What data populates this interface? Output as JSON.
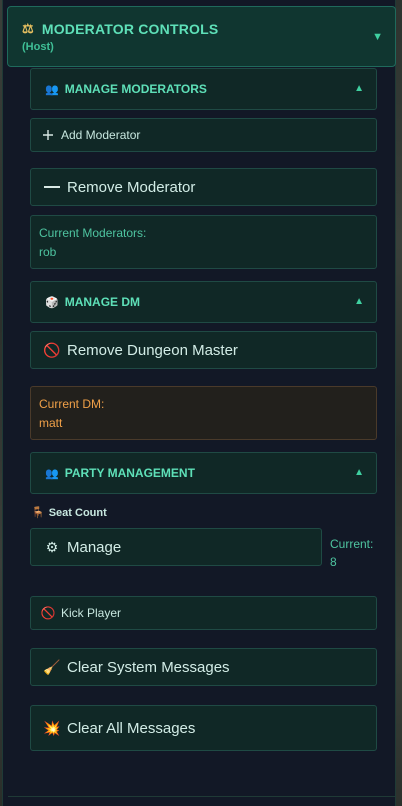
{
  "header": {
    "icon": "scales-icon",
    "title": "MODERATOR CONTROLS",
    "subtitle": "(Host)",
    "toggle": "▼"
  },
  "moderators": {
    "section_label": "MANAGE MODERATORS",
    "section_icon": "people-icon",
    "toggle": "▲",
    "add_label": "Add Moderator",
    "remove_label": "Remove Moderator",
    "current_label": "Current Moderators:",
    "current_value": "rob"
  },
  "dm": {
    "section_label": "MANAGE DM",
    "section_icon": "die-icon",
    "toggle": "▲",
    "remove_label": "Remove Dungeon Master",
    "current_label": "Current DM:",
    "current_value": "matt"
  },
  "party": {
    "section_label": "PARTY MANAGEMENT",
    "section_icon": "people-icon",
    "toggle": "▲",
    "seat_label": "Seat Count",
    "manage_label": "Manage",
    "current_label": "Current:",
    "current_value": "8",
    "kick_label": "Kick Player"
  },
  "actions": {
    "clear_system_label": "Clear System Messages",
    "clear_all_label": "Clear All Messages"
  },
  "colors": {
    "accent": "#5ee0b8",
    "panel": "#121826",
    "dm_accent": "#f0a048"
  }
}
